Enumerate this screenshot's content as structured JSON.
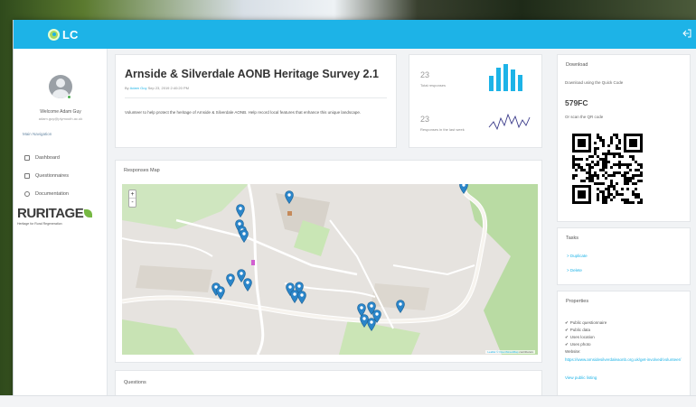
{
  "app": {
    "logo": "LC"
  },
  "sidebar": {
    "welcome": "Welcome Adam Guy",
    "email": "adam.guy@plymouth.ac.uk",
    "nav_heading": "Main Navigation",
    "items": [
      {
        "label": "Dashboard",
        "icon": "dashboard-icon"
      },
      {
        "label": "Questionnaires",
        "icon": "questionnaires-icon"
      },
      {
        "label": "Documentation",
        "icon": "documentation-icon"
      }
    ],
    "brand": {
      "name": "RURITAGE",
      "tagline": "Heritage for Rural Regeneration"
    }
  },
  "survey": {
    "title": "Arnside & Silverdale AONB Heritage Survey 2.1",
    "meta_prefix": "By",
    "author": "Adam Guy",
    "date": "Sep 23, 2019 2:40:20 PM",
    "description": "Volunteer to help protect the heritage of Arnside & Silverdale AONB. Help record local features that enhance this unique landscape."
  },
  "stats": {
    "total_count": "23",
    "total_label": "Total responses",
    "week_count": "23",
    "week_label": "Responses in the last week",
    "bar_levels": [
      0.55,
      0.85,
      1.0,
      0.8,
      0.6
    ]
  },
  "map_card": {
    "heading": "Responses Map",
    "zoom_in": "+",
    "zoom_out": "-",
    "attribution_prefix": "Leaflet",
    "attribution_osm": "© OpenStreetMap",
    "attribution_suffix": "contributors",
    "pin_color": "#2a85c9"
  },
  "questions": {
    "heading": "Questions"
  },
  "download": {
    "heading": "Download",
    "instruction": "Download using the Quick Code",
    "code": "579FC",
    "qr_hint": "Or scan the QR code"
  },
  "tasks": {
    "heading": "Tasks",
    "items": [
      "> Duplicate",
      "> Delete"
    ]
  },
  "properties": {
    "heading": "Properties",
    "items": [
      "Public questionnaire",
      "Public data",
      "Uses location",
      "Uses photo"
    ],
    "website_label": "Website:",
    "website_url": "https://www.arnsidesilverdaleaonb.org.uk/get-involved/volunteer/",
    "public_listing": "View public listing"
  },
  "colors": {
    "accent": "#1db3e7",
    "pin": "#2a85c9",
    "brand_green": "#76b843"
  }
}
